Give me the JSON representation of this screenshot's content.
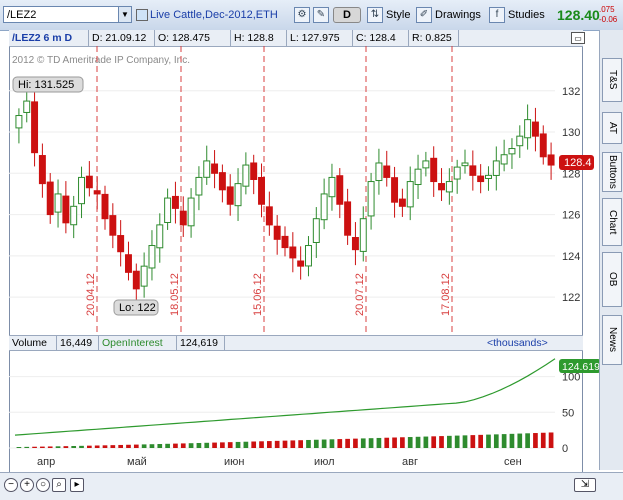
{
  "toolbar": {
    "symbol": "/LEZ2",
    "description": "Live Cattle,Dec-2012,ETH",
    "period_button": "D",
    "style_label": "Style",
    "drawings_label": "Drawings",
    "studies_label": "Studies",
    "last_price": "128.40",
    "change1": ".075",
    "change2": "-0.06"
  },
  "infobar": {
    "title": "/LEZ2 6 m D",
    "date": "D: 21.09.12",
    "open": "O: 128.475",
    "high": "H: 128.8",
    "low": "L: 127.975",
    "close": "C: 128.4",
    "range": "R: 0.825"
  },
  "chart": {
    "copyright": "2012 © TD Ameritrade IP Company, Inc.",
    "hi_label": "Hi: 131.525",
    "lo_label": "Lo: 122",
    "price_tag": "128.4",
    "price_ticks": [
      "132",
      "130",
      "128",
      "126",
      "124",
      "122"
    ],
    "expiry_lines": [
      "20.04.12",
      "18.05.12",
      "15.06.12",
      "20.07.12",
      "17.08.12"
    ],
    "colors": {
      "up": "#2e8b2e",
      "down": "#cc1111",
      "expiry": "#d84040",
      "oi": "#2e9a2e"
    }
  },
  "chart_data": {
    "type": "candlestick",
    "title": "/LEZ2 6 m D",
    "ylim": [
      120.6,
      133.2
    ],
    "x_months": [
      "апр",
      "май",
      "июн",
      "июл",
      "авг",
      "сен"
    ],
    "close_series_approx": [
      130.8,
      131.5,
      129.0,
      127.5,
      126.0,
      127.0,
      125.6,
      126.4,
      127.8,
      127.3,
      127.0,
      125.8,
      125.0,
      124.2,
      123.2,
      122.4,
      123.5,
      124.5,
      125.5,
      126.8,
      126.3,
      125.5,
      126.8,
      127.8,
      128.6,
      128.0,
      127.2,
      126.5,
      127.5,
      128.4,
      127.7,
      126.5,
      125.5,
      124.8,
      124.4,
      123.9,
      123.5,
      124.5,
      125.8,
      127.0,
      127.8,
      126.5,
      125.0,
      124.3,
      125.8,
      127.6,
      128.5,
      127.8,
      126.6,
      126.4,
      127.6,
      128.2,
      128.6,
      127.6,
      127.2,
      127.6,
      128.3,
      128.5,
      127.9,
      127.6,
      127.9,
      128.6,
      128.9,
      129.2,
      129.8,
      130.6,
      129.8,
      128.8,
      128.4
    ],
    "high": 131.525,
    "low": 122,
    "last": 128.4
  },
  "volume": {
    "label": "Volume",
    "value": "16,449",
    "oi_label": "OpenInterest",
    "oi_value": "124,619",
    "units": "<thousands>",
    "oi_tag": "124.619",
    "ticks": [
      "100",
      "50",
      "0"
    ]
  },
  "rtabs": [
    "T&S",
    "AT",
    "Buttons",
    "Chart",
    "OB",
    "News"
  ],
  "months": [
    "апр",
    "май",
    "июн",
    "июл",
    "авг",
    "сен"
  ]
}
